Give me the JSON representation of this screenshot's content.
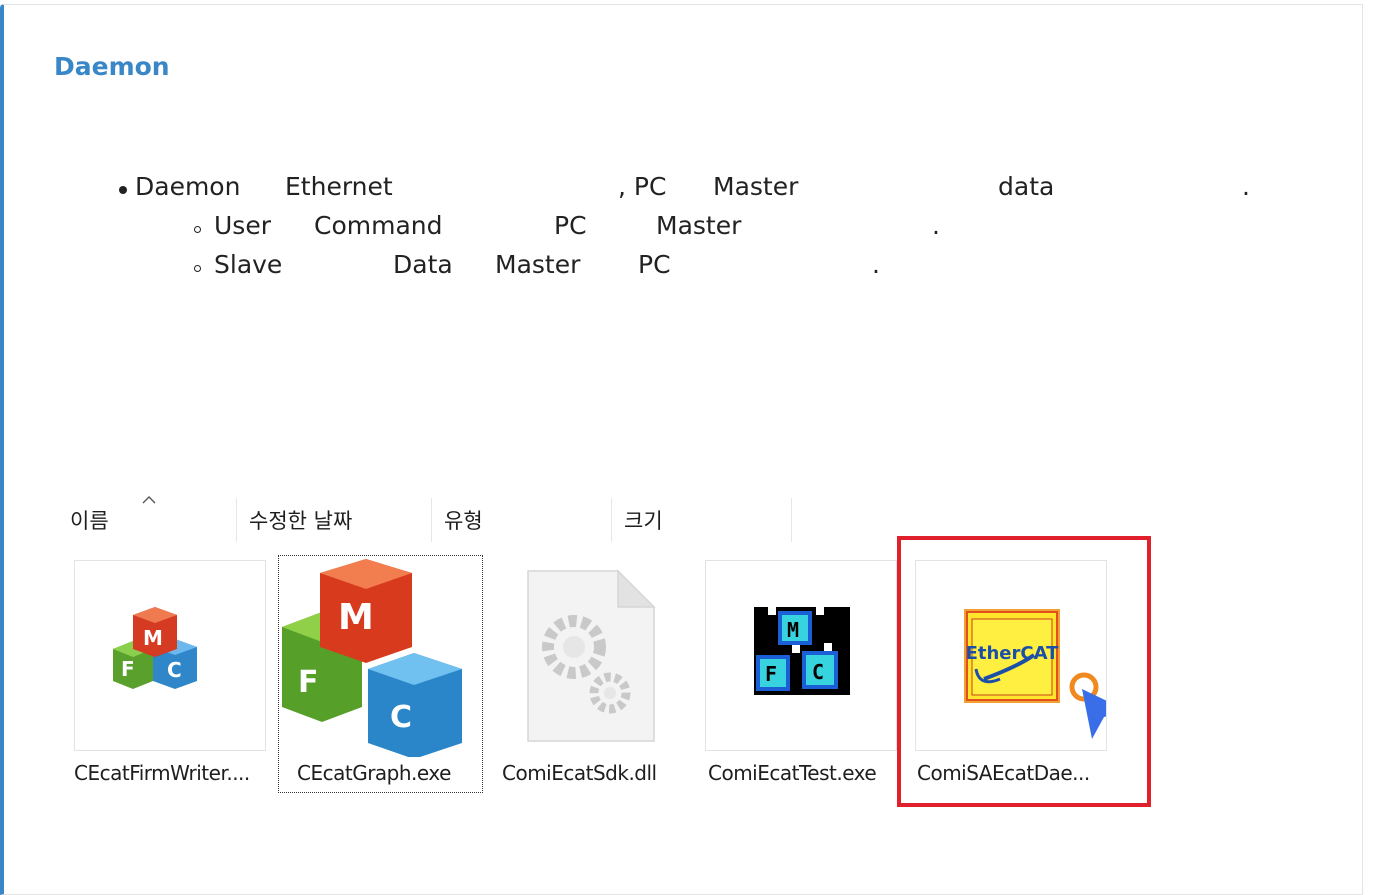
{
  "section": {
    "title": "Daemon"
  },
  "bullets": {
    "b1": [
      "Daemon",
      "Ethernet",
      ", PC",
      "Master",
      "data",
      "."
    ],
    "b2": [
      "User",
      "Command",
      "PC",
      "Master",
      "."
    ],
    "b3": [
      "Slave",
      "Data",
      "Master",
      "PC",
      "."
    ]
  },
  "explorer": {
    "columns": [
      "이름",
      "수정한 날짜",
      "유형",
      "크기"
    ],
    "sort_indicator": "chevron-up-icon",
    "files": [
      {
        "name": "CEcatFirmWriter....",
        "icon": "mfc-cubes-icon"
      },
      {
        "name": "CEcatGraph.exe",
        "icon": "mfc-cubes-icon",
        "focused": true
      },
      {
        "name": "ComiEcatSdk.dll",
        "icon": "dll-gear-file-icon"
      },
      {
        "name": "ComiEcatTest.exe",
        "icon": "mfc-pixel-cubes-icon"
      },
      {
        "name": "ComiSAEcatDae...",
        "icon": "ethercat-icon",
        "highlighted": true
      }
    ],
    "ethercat_logo_text": "EtherCAT",
    "highlight_color": "#e0202b",
    "accent_color": "#3a87c8"
  }
}
